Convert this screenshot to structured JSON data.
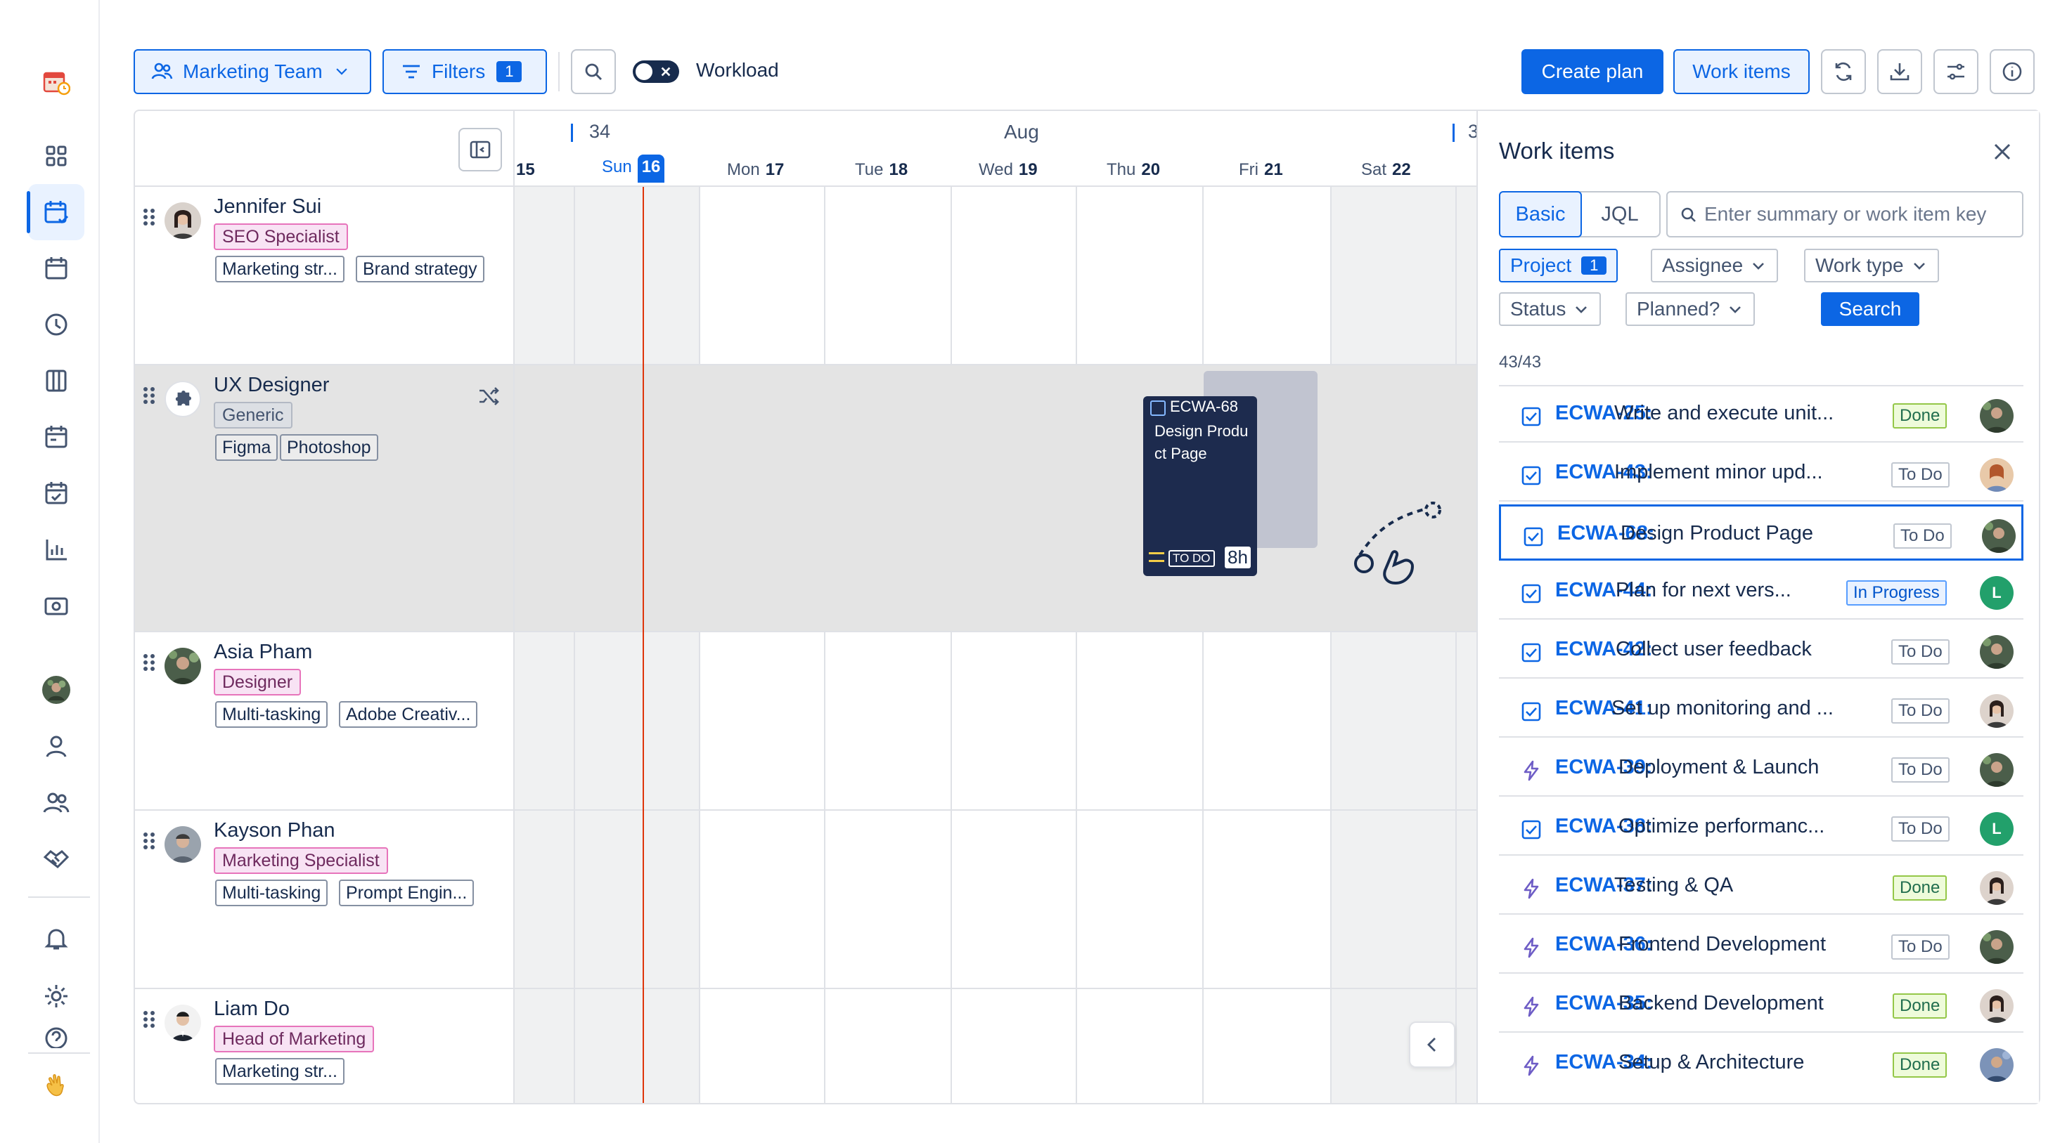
{
  "toolbar": {
    "team_label": "Marketing Team",
    "filters_label": "Filters",
    "filters_count": "1",
    "workload_label": "Workload",
    "create_plan_label": "Create plan",
    "work_items_label": "Work items"
  },
  "timeline": {
    "week_left": "34",
    "week_right": "3",
    "month": "Aug",
    "days": [
      {
        "name": "",
        "num": "15"
      },
      {
        "name": "Sun",
        "num": "16"
      },
      {
        "name": "Mon",
        "num": "17"
      },
      {
        "name": "Tue",
        "num": "18"
      },
      {
        "name": "Wed",
        "num": "19"
      },
      {
        "name": "Thu",
        "num": "20"
      },
      {
        "name": "Fri",
        "num": "21"
      },
      {
        "name": "Sat",
        "num": "22"
      }
    ]
  },
  "resources": [
    {
      "name": "Jennifer Sui",
      "role": "SEO Specialist",
      "skills": [
        "Marketing str...",
        "Brand strategy"
      ]
    },
    {
      "name": "UX Designer",
      "role": "Generic",
      "skills": [
        "Figma",
        "Photoshop"
      ]
    },
    {
      "name": "Asia Pham",
      "role": "Designer",
      "skills": [
        "Multi-tasking",
        "Adobe Creativ..."
      ]
    },
    {
      "name": "Kayson Phan",
      "role": "Marketing Specialist",
      "skills": [
        "Multi-tasking",
        "Prompt Engin..."
      ]
    },
    {
      "name": "Liam Do",
      "role": "Head of Marketing",
      "skills": [
        "Marketing str..."
      ]
    }
  ],
  "card": {
    "key": "ECWA-68",
    "summary": "Design Product Page",
    "status": "TO DO",
    "hours": "8h"
  },
  "panel": {
    "title": "Work items",
    "tab_basic": "Basic",
    "tab_jql": "JQL",
    "search_placeholder": "Enter summary or work item key",
    "filter_project": "Project",
    "filter_project_count": "1",
    "filter_assignee": "Assignee",
    "filter_worktype": "Work type",
    "filter_status": "Status",
    "filter_planned": "Planned?",
    "search_button": "Search",
    "count": "43/43",
    "items": [
      {
        "key": "ECWA-25:",
        "summary": "Write and execute unit...",
        "status": "Done",
        "type": "task"
      },
      {
        "key": "ECWA-43:",
        "summary": "Implement minor upd...",
        "status": "To Do",
        "type": "task"
      },
      {
        "key": "ECWA-68:",
        "summary": "Design Product Page",
        "status": "To Do",
        "type": "task"
      },
      {
        "key": "ECWA-44:",
        "summary": "Plan for next vers...",
        "status": "In Progress",
        "type": "task"
      },
      {
        "key": "ECWA-42:",
        "summary": "Collect user feedback",
        "status": "To Do",
        "type": "task"
      },
      {
        "key": "ECWA-41:",
        "summary": "Set up monitoring and ...",
        "status": "To Do",
        "type": "task"
      },
      {
        "key": "ECWA-39:",
        "summary": "Deployment & Launch",
        "status": "To Do",
        "type": "epic"
      },
      {
        "key": "ECWA-38:",
        "summary": "Optimize performanc...",
        "status": "To Do",
        "type": "task"
      },
      {
        "key": "ECWA-37:",
        "summary": "Testing & QA",
        "status": "Done",
        "type": "epic"
      },
      {
        "key": "ECWA-36:",
        "summary": "Frontend Development",
        "status": "To Do",
        "type": "epic"
      },
      {
        "key": "ECWA-35:",
        "summary": "Backend Development",
        "status": "Done",
        "type": "epic"
      },
      {
        "key": "ECWA-34:",
        "summary": "Setup & Architecture",
        "status": "Done",
        "type": "epic"
      }
    ],
    "avatar_initial": "L"
  },
  "colors": {
    "accent": "#0c66e4",
    "card": "#1d2b4e",
    "today_line": "#de350b"
  }
}
